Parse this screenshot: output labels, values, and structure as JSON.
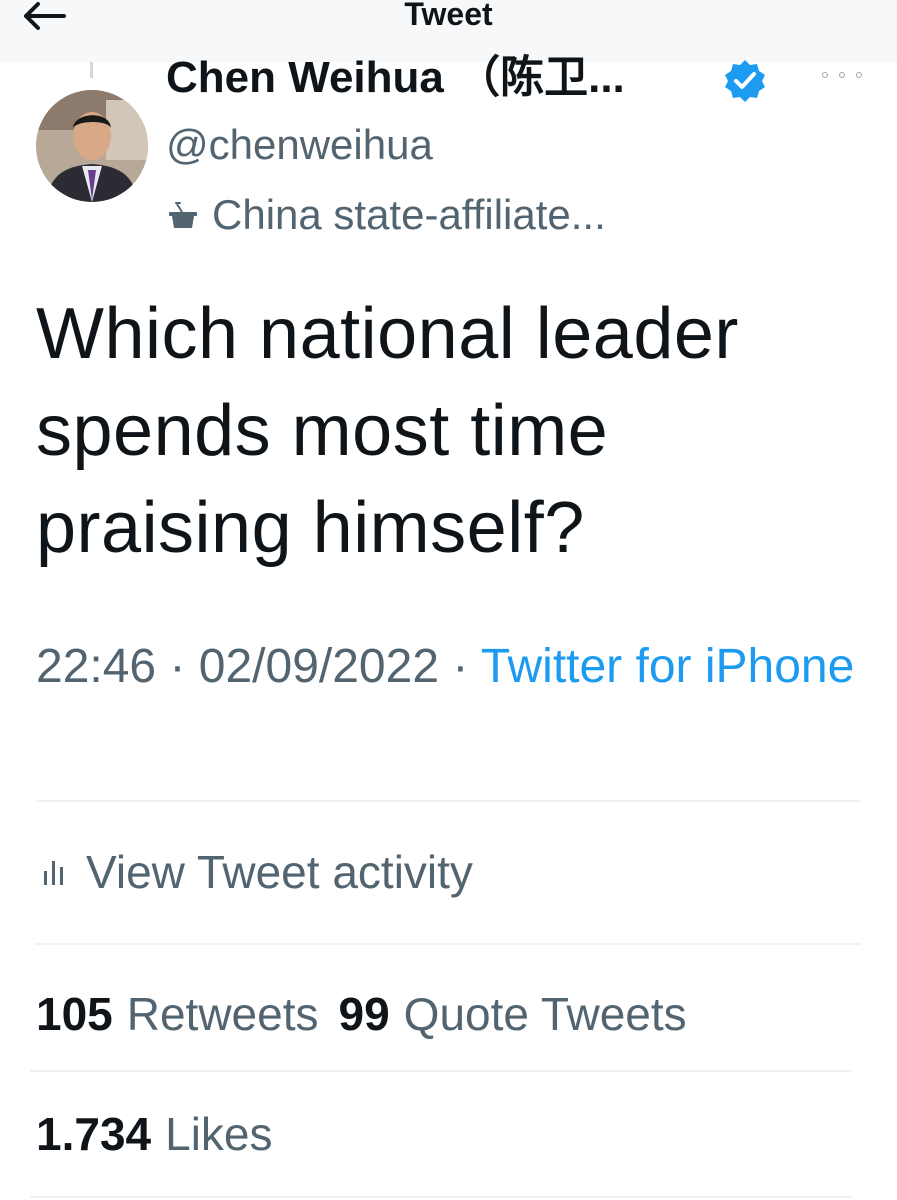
{
  "header": {
    "title": "Tweet",
    "back_icon": "arrow-left-icon"
  },
  "author": {
    "display_name": "Chen Weihua （陈卫...",
    "handle": "@chenweihua",
    "verified_icon": "verified-badge-icon",
    "affiliation_label": "China state-affiliate...",
    "affiliation_icon": "podium-icon"
  },
  "tweet": {
    "text_lines": [
      "Which national leader",
      "spends most time",
      "praising himself?"
    ],
    "time": "22:46",
    "separator": " · ",
    "date": "02/09/2022",
    "source": "Twitter for iPhone"
  },
  "activity": {
    "label": "View Tweet activity",
    "icon": "bar-chart-icon"
  },
  "stats": {
    "retweets_count": "105",
    "retweets_label": "Retweets",
    "quotes_count": "99",
    "quotes_label": "Quote Tweets",
    "likes_count": "1.734",
    "likes_label": "Likes"
  },
  "colors": {
    "text_primary": "#0f1419",
    "text_secondary": "#536471",
    "link_blue": "#1d9bf0",
    "verified_blue": "#1d9bf0",
    "divider": "#eff3f4"
  }
}
